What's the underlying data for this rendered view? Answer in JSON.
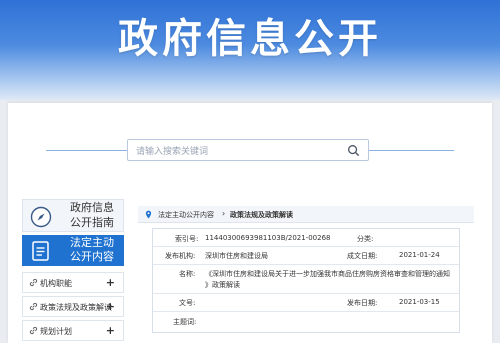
{
  "hero": {
    "title": "政府信息公开"
  },
  "search": {
    "placeholder": "请输入搜索关键词"
  },
  "menu": {
    "guide": {
      "line1": "政府信息",
      "line2": "公开指南"
    },
    "active": {
      "line1": "法定主动",
      "line2": "公开内容"
    },
    "items": [
      {
        "label": "机构职能",
        "plus": "+"
      },
      {
        "label": "政策法规及政策解读",
        "plus": "+"
      },
      {
        "label": "规划计划",
        "plus": "+"
      }
    ]
  },
  "breadcrumb": {
    "level1": "法定主动公开内容",
    "separator": "›",
    "level2": "政策法规及政策解读"
  },
  "info": {
    "index_label": "索引号:",
    "index_value": "11440300693981103B/2021-00268",
    "category_label": "分类:",
    "category_value": "",
    "publisher_label": "发布机构:",
    "publisher_value": "深圳市住房和建设局",
    "date_label": "成文日期:",
    "date_value": "2021-01-24",
    "name_label": "名称:",
    "name_line1": "《深圳市住房和建设局关于进一步加强我市商品住房购房资格审查和管理的通知",
    "name_line2": "》政策解读",
    "docno_label": "文号:",
    "docno_value": "",
    "pubdate_label": "发布日期:",
    "pubdate_value": "2021-03-15",
    "subject_label": "主题词:",
    "subject_value": ""
  },
  "colors": {
    "brand_blue": "#1f72cf",
    "hero_blue": "#2f71d6"
  }
}
